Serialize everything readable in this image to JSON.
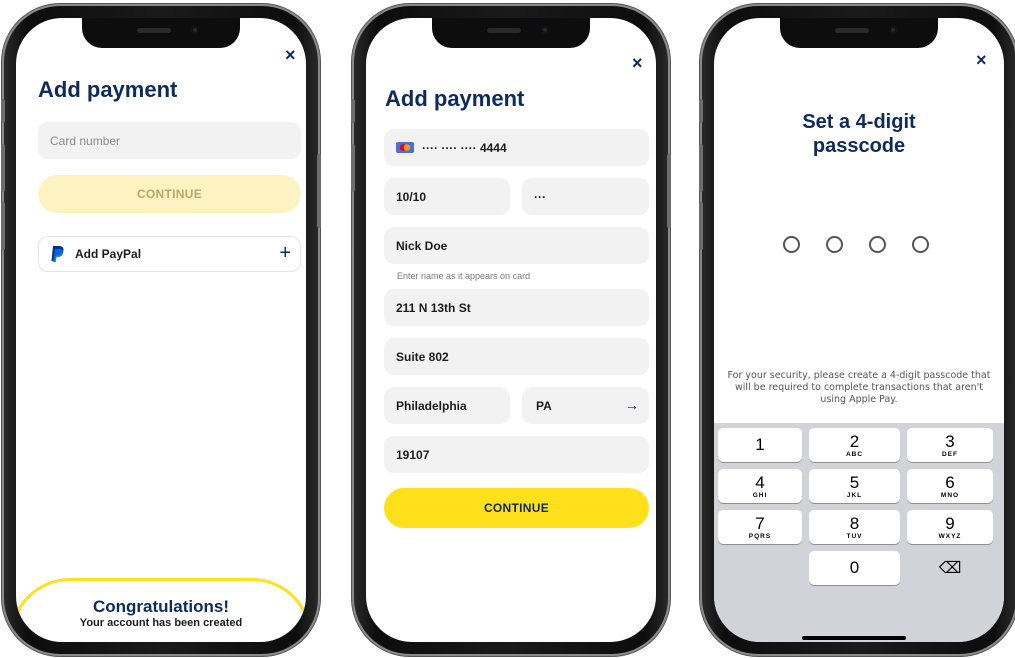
{
  "screen1": {
    "title": "Add payment",
    "close": "×",
    "card_placeholder": "Card number",
    "continue_label": "CONTINUE",
    "paypal_label": "Add PayPal",
    "paypal_plus": "+",
    "congrats_title": "Congratulations!",
    "congrats_sub": "Your account has been created"
  },
  "screen2": {
    "title": "Add payment",
    "close": "×",
    "card_number": "···· ···· ···· 4444",
    "expiry": "10/10",
    "cvv": "···",
    "name": "Nick Doe",
    "name_hint": "Enter name as it appears on card",
    "address1": "211 N 13th St",
    "address2": "Suite 802",
    "city": "Philadelphia",
    "state": "PA",
    "state_arrow": "→",
    "zip": "19107",
    "continue_label": "CONTINUE"
  },
  "screen3": {
    "title": "Set a 4-digit passcode",
    "close": "×",
    "info": "For your security, please create a 4-digit passcode that will be required to complete transactions that aren't using Apple Pay.",
    "keys": [
      {
        "n": "1",
        "l": ""
      },
      {
        "n": "2",
        "l": "ABC"
      },
      {
        "n": "3",
        "l": "DEF"
      },
      {
        "n": "4",
        "l": "GHI"
      },
      {
        "n": "5",
        "l": "JKL"
      },
      {
        "n": "6",
        "l": "MNO"
      },
      {
        "n": "7",
        "l": "PQRS"
      },
      {
        "n": "8",
        "l": "TUV"
      },
      {
        "n": "9",
        "l": "WXYZ"
      },
      {
        "n": "0",
        "l": ""
      }
    ],
    "delete_key": "⌫"
  },
  "colors": {
    "brand_navy": "#0d2b5c",
    "accent_yellow": "#ffe01b",
    "disabled_yellow": "#fdf3c2",
    "disabled_text": "#b8a96a",
    "field_bg": "#f2f2f2",
    "keypad_bg": "#d1d3d9"
  },
  "icons": {
    "paypal": "paypal-icon",
    "card": "mastercard-icon",
    "close": "close-icon",
    "arrow": "arrow-right-icon",
    "backspace": "backspace-icon"
  }
}
